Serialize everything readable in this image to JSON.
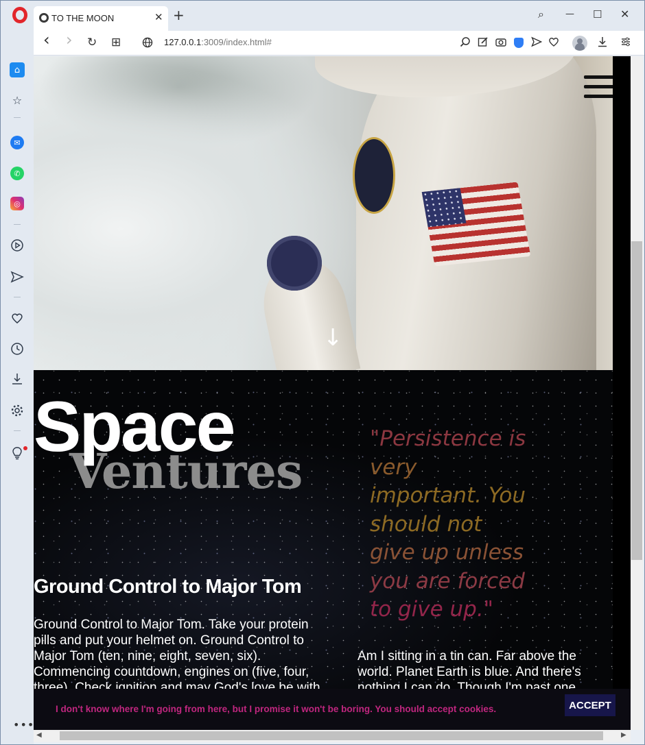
{
  "browser": {
    "tab_title": "TO THE MOON",
    "tab_close": "✕",
    "new_tab": "+",
    "url_host": "127.0.0.1",
    "url_rest": ":3009/index.html#",
    "window_controls": {
      "search": "⌕",
      "minimize": "—",
      "maximize": "☐",
      "close": "✕"
    },
    "nav": {
      "back": "‹",
      "forward": "›",
      "reload": "↻",
      "tabs": "⊞"
    }
  },
  "hero": {
    "scroll_arrow": "↓"
  },
  "intro": {
    "title_main": "Space",
    "title_sub": "Ventures",
    "quote_lines": [
      {
        "text": "\"Persistence is",
        "color": "#8c3740"
      },
      {
        "text": "very",
        "color": "#8a5a2c"
      },
      {
        "text": "important. You",
        "color": "#8d6a23"
      },
      {
        "text": "should not",
        "color": "#8d6a23"
      },
      {
        "text": "give up unless",
        "color": "#8a5235"
      },
      {
        "text": "you are forced",
        "color": "#8c3a44"
      },
      {
        "text": "to give up.\"",
        "color": "#93254a"
      }
    ],
    "ground_control": {
      "heading": "Ground Control to Major Tom",
      "body": "Ground Control to Major Tom. Take your protein pills and put your helmet on. Ground Control to Major Tom (ten, nine, eight, seven, six). Commencing countdown, engines on (five, four, three). Check ignition and may God's love be with you."
    },
    "tin_can": {
      "body": "Am I sitting in a tin can. Far above the world. Planet Earth is blue. And there's nothing I can do. Though I'm past one hundred thousand miles."
    }
  },
  "cookie_banner": {
    "text": "I don't know where I'm going from here, but I promise it won't be boring. You should accept cookies.",
    "accept_label": "ACCEPT"
  },
  "colors": {
    "opera_red": "#e2262b",
    "accent_blue": "#1d8bf0",
    "cookie_text": "#c0267f",
    "cookie_button": "#17164a"
  }
}
